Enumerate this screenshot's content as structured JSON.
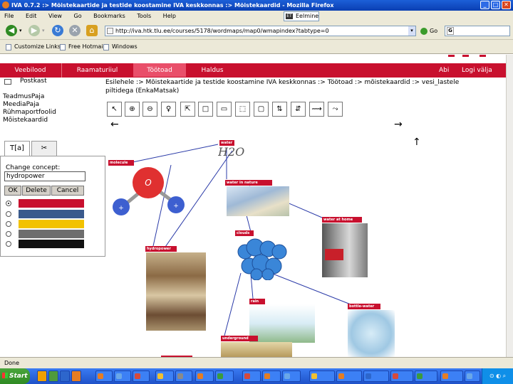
{
  "window": {
    "title": "IVA 0.7.2 :> Mõistekaartide ja testide koostamine IVA keskkonnas :> Mõistekaardid - Mozilla Firefox",
    "controls": [
      "_",
      "□",
      "✕"
    ]
  },
  "menubar": {
    "items": [
      "File",
      "Edit",
      "View",
      "Go",
      "Bookmarks",
      "Tools",
      "Help"
    ],
    "extra_box": "Eelmine"
  },
  "navbar": {
    "url": "http://iva.htk.tlu.ee/courses/5178/wordmaps/map0/wmapindex?tabtype=0",
    "go_label": "Go",
    "search_placeholder": ""
  },
  "bookmarks": {
    "items": [
      "Customize Links",
      "Free Hotmail",
      "Windows"
    ]
  },
  "site_nav": {
    "tabs": [
      "Veebilood",
      "Raamaturiiul",
      "Töötoad",
      "Haldus"
    ],
    "active_index": 2,
    "right_links": [
      "Abi",
      "Logi välja"
    ]
  },
  "sidebar": {
    "mailbox": "Postkast",
    "links": [
      "TeadmusPaja",
      "MeediaPaja",
      "Rühmaportfoolid",
      "Mõistekaardid"
    ],
    "tool_tabs": [
      "T[a]",
      "✂"
    ],
    "change_label": "Change concept:",
    "concept_value": "hydropower",
    "buttons": [
      "OK",
      "Delete",
      "Cancel"
    ],
    "colors": [
      "#c8102e",
      "#3a5a8c",
      "#f2c200",
      "#6e6e6e",
      "#111111"
    ],
    "selected_color_index": 0
  },
  "breadcrumb": "Esilehele :> Mõistekaartide ja testide koostamine IVA keskkonnas :> Töötoad :> mõistekaardid :> vesi_lastele piltidega (EnkaMatsak)",
  "toolbar": {
    "tools": [
      "↖",
      "⊕",
      "⊖",
      "♀",
      "⇱",
      "□",
      "▭",
      "⬚",
      "▢",
      "⇅",
      "⇵",
      "⟿",
      "⤳"
    ]
  },
  "map_arrows": {
    "left": "←",
    "right": "→",
    "up": "↑"
  },
  "map": {
    "root_label": "water",
    "root_formula": "H2O",
    "nodes": [
      "molecule",
      "water in nature",
      "water at home",
      "clouds",
      "hydropower",
      "rain",
      "bottle-water",
      "underground"
    ]
  },
  "statusbar": {
    "text": "Done"
  },
  "taskbar": {
    "start_label": "Start",
    "clock": "⊙ ◐ ⌕"
  }
}
